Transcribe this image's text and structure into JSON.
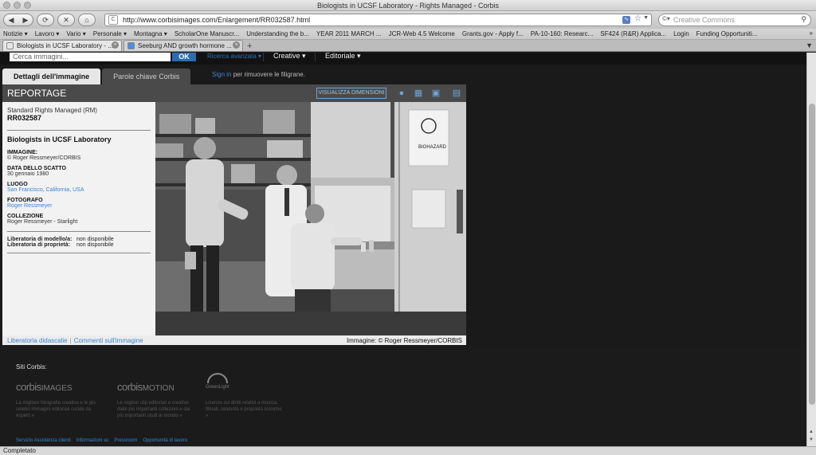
{
  "window": {
    "title": "Biologists in UCSF Laboratory - Rights Managed - Corbis"
  },
  "navbar": {
    "url": "http://www.corbisimages.com/Enlargement/RR032587.html",
    "search_placeholder": "Creative Commons"
  },
  "bookmarks": [
    "Notizie ▾",
    "Lavoro ▾",
    "Vario ▾",
    "Personale ▾",
    "Montagna ▾",
    "ScholarOne Manuscr...",
    "Understanding the b...",
    "YEAR 2011 MARCH ...",
    "JCR-Web 4.5 Welcome",
    "Grants.gov - Apply f...",
    "PA-10-160: Researc...",
    "SF424 (R&R) Applica...",
    "Login",
    "Funding Opportuniti..."
  ],
  "bookmarks_more": "»",
  "tabs": [
    {
      "label": "Biologists in UCSF Laboratory - ..."
    },
    {
      "label": "Seeburg AND growth hormone ..."
    }
  ],
  "site": {
    "search_placeholder": "Cerca immagini...",
    "ok": "OK",
    "advanced": "Ricerca avanzata ▾",
    "nav_creative": "Creative ▾",
    "nav_editoriale": "Editoriale ▾"
  },
  "pagetabs": {
    "details": "Dettagli dell'immagine",
    "keywords": "Parole chiave Corbis",
    "signin_link": "Sign in",
    "signin_rest": " per rimuovere le filigrane."
  },
  "panel": {
    "header": "REPORTAGE",
    "visualize": "VISUALIZZA DIMENSIONI",
    "rights": "Standard Rights Managed (RM)",
    "id": "RR032587",
    "image_title": "Biologists in UCSF Laboratory",
    "fields": [
      {
        "label": "IMMAGINE:",
        "value": "© Roger Ressmeyer/CORBIS",
        "link": false
      },
      {
        "label": "DATA DELLO SCATTO",
        "value": "30 gennaio 1980",
        "link": false
      },
      {
        "label": "LUOGO",
        "value": "San Francisco, California, USA",
        "link": true
      },
      {
        "label": "FOTOGRAFO",
        "value": "Roger Ressmeyer",
        "link": true
      },
      {
        "label": "COLLEZIONE",
        "value": "Roger Ressmeyer - Starlight",
        "link": false
      }
    ],
    "release_model_label": "Liberatoria di modello/a:",
    "release_model_value": "non disponibile",
    "release_property_label": "Liberatoria di proprietà:",
    "release_property_value": "non disponibile",
    "photo_biohazard": "BIOHAZARD",
    "caption_link1": "Liberatoria didascalie",
    "caption_link2": "Commenti sull'immagine",
    "credit": "Immagine: © Roger Ressmeyer/CORBIS"
  },
  "footer": {
    "siti": "Siti Corbis:",
    "brand1": "corbis",
    "brand1b": "IMAGES",
    "brand2": "corbis",
    "brand2b": "MOTION",
    "greenlight": "GreenLight",
    "desc1": "La migliore fotografia creativa e le più celebri immagini editoriali curate da esperti »",
    "desc2": "Le migliori clip editoriali e creative dalle più importanti collezioni e dai più importanti studi al mondo »",
    "desc3": "Licenze sui diritti relativi a musica, filmati, celebrità e proprietà iconiche »",
    "links": [
      "Servizio Assistenza clienti",
      "Informazioni su",
      "Pressroom",
      "Opportunità di lavoro"
    ]
  },
  "status": {
    "text": "Completato"
  }
}
